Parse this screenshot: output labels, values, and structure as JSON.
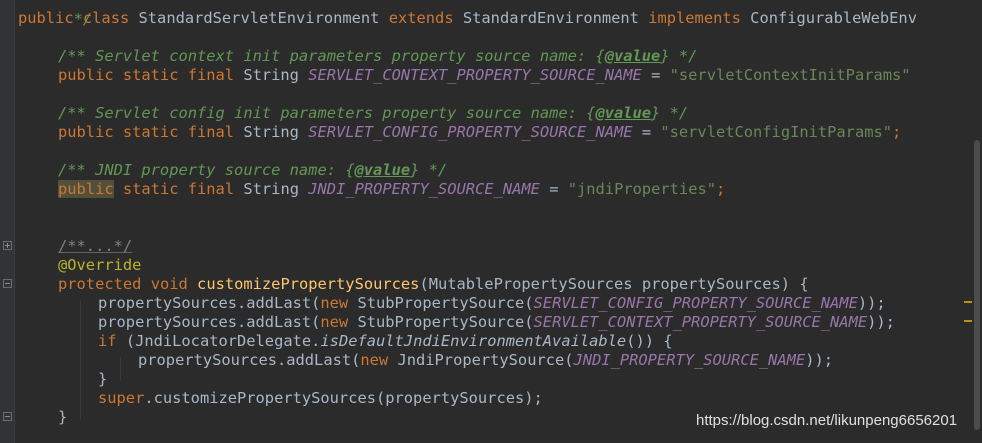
{
  "editor": {
    "top_fragment": "*/",
    "class_decl": {
      "kw_public": "public",
      "kw_class": "class",
      "class_name": "StandardServletEnvironment",
      "kw_extends": "extends",
      "super_name": "StandardEnvironment",
      "kw_implements": "implements",
      "iface_name": "ConfigurableWebEnv"
    },
    "fields": [
      {
        "doc_prefix": "/** Servlet context init parameters property source name: {",
        "doc_tag": "@value",
        "doc_suffix": "} */",
        "modifiers": "public static final",
        "type": "String",
        "name": "SERVLET_CONTEXT_PROPERTY_SOURCE_NAME",
        "eq": " = ",
        "value": "\"servletContextInitParams\"",
        "end": ""
      },
      {
        "doc_prefix": "/** Servlet config init parameters property source name: {",
        "doc_tag": "@value",
        "doc_suffix": "} */",
        "modifiers": "public static final",
        "type": "String",
        "name": "SERVLET_CONFIG_PROPERTY_SOURCE_NAME",
        "eq": " = ",
        "value": "\"servletConfigInitParams\"",
        "end": ";"
      },
      {
        "doc_prefix": "/** JNDI property source name: {",
        "doc_tag": "@value",
        "doc_suffix": "} */",
        "modifier_public": "public",
        "modifiers_rest": "static final",
        "type": "String",
        "name": "JNDI_PROPERTY_SOURCE_NAME",
        "eq": " = ",
        "value": "\"jndiProperties\"",
        "end": ";"
      }
    ],
    "method": {
      "folded_doc": "/**...*/",
      "annotation": "@Override",
      "kw_protected": "protected",
      "kw_void": "void",
      "name": "customizePropertySources",
      "params": "(MutablePropertySources propertySources) {",
      "line1": {
        "pre": "propertySources.addLast(",
        "kw_new": "new",
        "mid": " StubPropertySource(",
        "const": "SERVLET_CONFIG_PROPERTY_SOURCE_NAME",
        "post": "));"
      },
      "line2": {
        "pre": "propertySources.addLast(",
        "kw_new": "new",
        "mid": " StubPropertySource(",
        "const": "SERVLET_CONTEXT_PROPERTY_SOURCE_NAME",
        "post": "));"
      },
      "if_line": {
        "kw_if": "if",
        "pre": " (JndiLocatorDelegate.",
        "call": "isDefaultJndiEnvironmentAvailable",
        "post": "()) {"
      },
      "line3": {
        "pre": "propertySources.addLast(",
        "kw_new": "new",
        "mid": " JndiPropertySource(",
        "const": "JNDI_PROPERTY_SOURCE_NAME",
        "post": "));"
      },
      "close_if": "}",
      "super_line": {
        "kw_super": "super",
        "rest": ".customizePropertySources(propertySources);"
      },
      "close_method": "}"
    },
    "watermark": "https://blog.csdn.net/likunpeng6656201",
    "colors": {
      "background": "#2b2b2b",
      "keyword": "#cc7832",
      "doc_comment": "#629755",
      "constant": "#9876aa",
      "string": "#6a8759",
      "annotation": "#bbb529",
      "method_decl": "#ffc66d",
      "plain": "#a9b7c6"
    }
  }
}
